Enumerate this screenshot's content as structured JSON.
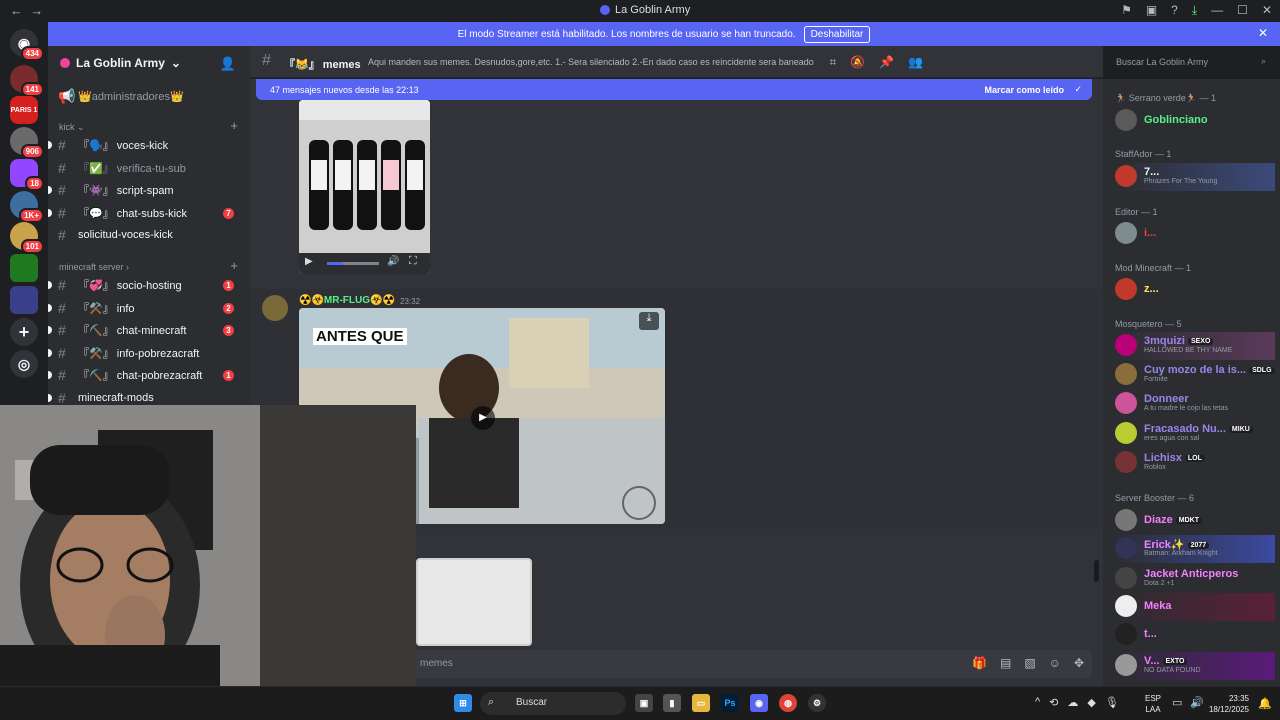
{
  "window": {
    "title": "La Goblin Army",
    "back": "←",
    "forward": "→"
  },
  "streamer_bar": {
    "text": "El modo Streamer está habilitado. Los nombres de usuario se han truncado.",
    "button": "Deshabilitar"
  },
  "rail": {
    "badges": [
      "434",
      "141",
      "906",
      "18",
      "1K+",
      "101"
    ],
    "logo_text": "PARIS 1"
  },
  "sidebar": {
    "server_name": "La Goblin Army",
    "admin_channel": "👑administradores👑",
    "category_kick": "kick",
    "category_minecraft": "minecraft server",
    "channels": [
      {
        "label": "『🗣️』 voces-kick",
        "unread": ""
      },
      {
        "label": "『✅』 verifica-tu-sub",
        "unread": ""
      },
      {
        "label": "『👾』 script-spam",
        "unread": ""
      },
      {
        "label": "『💬』 chat-subs-kick",
        "unread": "7"
      },
      {
        "label": "solicitud-voces-kick",
        "unread": ""
      },
      {
        "label": "『💞』 socio-hosting",
        "unread": "1"
      },
      {
        "label": "『⚒️』 info",
        "unread": "2"
      },
      {
        "label": "『⛏️』 chat-minecraft",
        "unread": "3"
      },
      {
        "label": "『⚒️』 info-pobrezacraft",
        "unread": ""
      },
      {
        "label": "『⛏️』 chat-pobrezacraft",
        "unread": "1"
      },
      {
        "label": "minecraft-mods",
        "unread": ""
      }
    ]
  },
  "header": {
    "channel": "『😹』 memes",
    "topic": "Aqui manden sus memes. Desnudos,gore,etc. 1.- Sera silenciado 2.-En dado caso es reincidente sera baneado",
    "search_placeholder": "Buscar La Goblin Army"
  },
  "new_messages": {
    "text": "47 mensajes nuevos desde las 22:13",
    "mark_read": "Marcar como leído"
  },
  "message": {
    "author": "☢️☣️MR-FLUG☣️☢️",
    "time": "23:32",
    "video_caption": "ANTES QUE"
  },
  "composer": {
    "placeholder": "memes"
  },
  "members": {
    "groups": [
      {
        "title": "🏃🏻 Serrano verde🏃🏻 — 1",
        "members": [
          {
            "name": "Goblinciano",
            "status": "",
            "tag": "",
            "color": "#57f287"
          }
        ]
      },
      {
        "title": "StaffAdor — 1",
        "members": [
          {
            "name": "7...",
            "status": "Phrazes For The Young",
            "tag": "",
            "color": "#f2f3f5"
          }
        ]
      },
      {
        "title": "Editor — 1",
        "members": [
          {
            "name": "i...",
            "status": "",
            "tag": "",
            "color": "#f23f43"
          }
        ]
      },
      {
        "title": "Mod Minecraft — 1",
        "members": [
          {
            "name": "z...",
            "status": "",
            "tag": "",
            "color": "#fee75c"
          }
        ]
      },
      {
        "title": "Mosquetero — 5",
        "members": [
          {
            "name": "3mquizi",
            "status": "HALLOWED BE THY NAME",
            "tag": "SEXO",
            "color": "#9b84ec"
          },
          {
            "name": "Cuy mozo de la is...",
            "status": "Fortnite",
            "tag": "SDLG",
            "color": "#9b84ec"
          },
          {
            "name": "Donneer",
            "status": "A tu madre le cojo las tetas",
            "tag": "",
            "color": "#9b84ec"
          },
          {
            "name": "Fracasado Nu...",
            "status": "eres agua con sal",
            "tag": "MIKU",
            "color": "#9b84ec"
          },
          {
            "name": "Lichisx",
            "status": "Roblox",
            "tag": "LOL",
            "color": "#9b84ec"
          }
        ]
      },
      {
        "title": "Server Booster — 6",
        "members": [
          {
            "name": "Diaze",
            "status": "",
            "tag": "MDKT",
            "color": "#f47fff"
          },
          {
            "name": "Erick✨",
            "status": "Batman: Arkham Knight",
            "tag": "2077",
            "color": "#f47fff"
          },
          {
            "name": "Jacket Anticperos",
            "status": "Dota 2 +1",
            "tag": "",
            "color": "#f47fff"
          },
          {
            "name": "Meka",
            "status": "",
            "tag": "",
            "color": "#f47fff"
          },
          {
            "name": "t...",
            "status": "",
            "tag": "",
            "color": "#f47fff"
          },
          {
            "name": "V...",
            "status": "NO DATA FOUND",
            "tag": "EXTO",
            "color": "#f47fff"
          }
        ]
      }
    ]
  },
  "taskbar": {
    "search": "Buscar",
    "lang": "ESP",
    "layout": "LAA",
    "time": "23:35",
    "date": "18/12/2025"
  },
  "colors": {
    "blurple": "#5865f2",
    "red": "#f23f43",
    "green": "#57f287",
    "bg": "#313338",
    "sidebar": "#2b2d31"
  }
}
